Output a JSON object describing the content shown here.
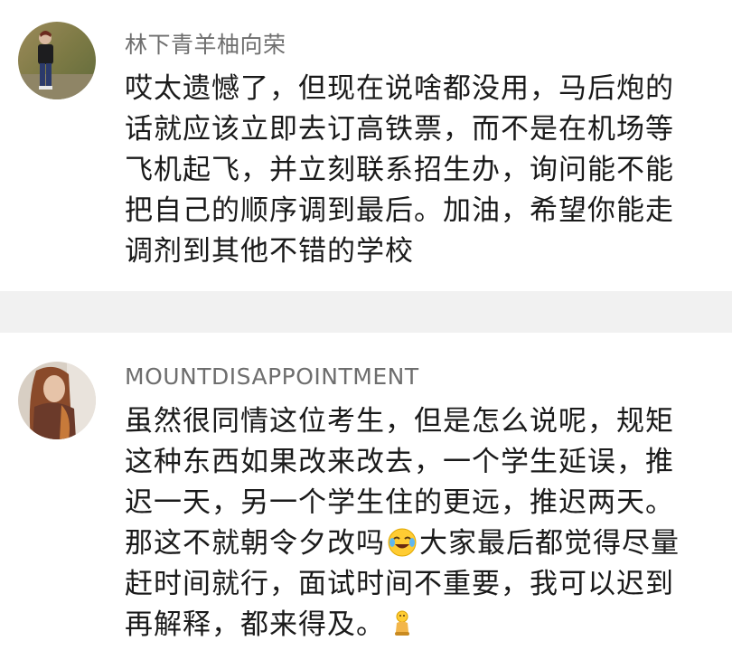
{
  "comments": [
    {
      "username": "林下青羊柚向荣",
      "avatar_icon": "user-avatar-standing-person",
      "lines": [
        "哎太遗憾了，但现在说啥都没用，马后炮的",
        "话就应该立即去订高铁票，而不是在机场等",
        "飞机起飞，并立刻联系招生办，询问能不能",
        "把自己的顺序调到最后。加油，希望你能走",
        "调剂到其他不错的学校"
      ]
    },
    {
      "username": "MOUNTDISAPPOINTMENT",
      "avatar_icon": "user-avatar-portrait",
      "lines": [
        "虽然很同情这位考生，但是怎么说呢，规矩",
        "这种东西如果改来改去，一个学生延误，推",
        "迟一天，另一个学生住的更远，推迟两天。",
        "那这不就朝令夕改吗",
        "大家最后都觉得尽量",
        "赶时间就行，面试时间不重要，我可以迟到",
        "再解释，都来得及。"
      ],
      "emojis": [
        "laughing-crying-emoji",
        "kneeling-person-emoji"
      ]
    }
  ],
  "colors": {
    "background": "#f1f1f1",
    "card": "#ffffff",
    "username": "#6e6e6e",
    "text": "#1a1a1a"
  }
}
